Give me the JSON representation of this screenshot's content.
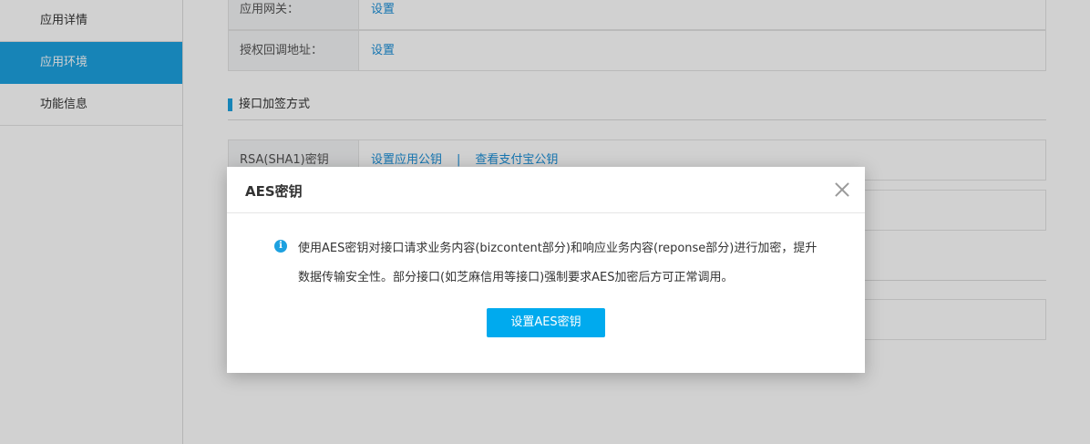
{
  "sidebar": {
    "items": [
      {
        "label": "应用详情"
      },
      {
        "label": "应用环境"
      },
      {
        "label": "功能信息"
      }
    ]
  },
  "main": {
    "rows": [
      {
        "label": "应用网关：",
        "link": "设置"
      },
      {
        "label": "授权回调地址：",
        "link": "设置"
      }
    ],
    "section_title": "接口加签方式",
    "rsa_row": {
      "label": "RSA(SHA1)密钥",
      "link1": "设置应用公钥",
      "separator": "|",
      "link2": "查看支付宝公钥"
    }
  },
  "modal": {
    "title": "AES密钥",
    "message_line1": "使用AES密钥对接口请求业务内容(bizcontent部分)和响应业务内容(reponse部分)进行加密，提升",
    "message_line2": "数据传输安全性。部分接口(如芝麻信用等接口)强制要求AES加密后方可正常调用。",
    "button_label": "设置AES密钥",
    "info_icon_glyph": "i"
  },
  "colors": {
    "accent": "#1da1e0",
    "button": "#00aaee",
    "link": "#1a8fd8"
  }
}
